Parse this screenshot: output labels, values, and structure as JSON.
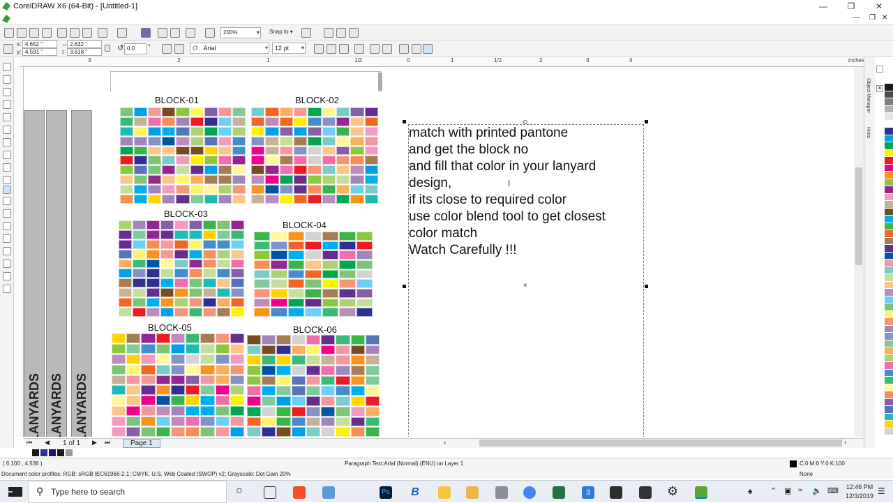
{
  "window": {
    "title": "CorelDRAW X6 (64-Bit) - [Untitled-1]"
  },
  "toolbar": {
    "zoom": "200%",
    "snap_to": "Snap to"
  },
  "property_bar": {
    "x": "4.652 \"",
    "y": "4.591 \"",
    "width": "2.632 \"",
    "height": "3.618 \"",
    "rotation": "0.0",
    "rotation_unit": "°",
    "font": "Arial",
    "font_size": "12 pt"
  },
  "ruler": {
    "units": "inches",
    "top_numbers": [
      "3",
      "2",
      "1",
      "1/2",
      "0",
      "1",
      "1/2",
      "2",
      "3",
      "4"
    ]
  },
  "artwork": {
    "lanyard_text": "LANYARDS",
    "blocks": [
      "BLOCK-01",
      "BLOCK-02",
      "BLOCK-03",
      "BLOCK-04",
      "BLOCK-05",
      "BLOCK-06"
    ]
  },
  "text_object": {
    "lines": [
      "match with printed pantone",
      "and get the block no",
      "and fill that color in your lanyard",
      "design,",
      "if its close to required color",
      "use color blend tool to get closest",
      "color match",
      "Watch Carefully !!!"
    ]
  },
  "page_nav": {
    "counter": "1 of 1",
    "page_tab": "Page 1"
  },
  "status": {
    "coords": "( 6.100 , 4.536 )",
    "object_info": "Paragraph Text:Arial (Normal) (ENU) on Layer 1",
    "fill": "C:0 M:0 Y:0 K:100",
    "outline": "None",
    "profiles": "Document color profiles: RGB: sRGB IEC61966-2.1; CMYK: U.S. Web Coated (SWOP) v2; Grayscale: Dot Gain 20%"
  },
  "docker_tabs": [
    "Object Manager",
    "Hints"
  ],
  "palette_colors": [
    "#1a1a1a",
    "#4d4d4d",
    "#808080",
    "#b3b3b3",
    "#e6e6e6",
    "#ffffff",
    "#2e3192",
    "#00a0e9",
    "#00a651",
    "#fff200",
    "#ed1c24",
    "#ec008c",
    "#f7941d",
    "#8dc63f",
    "#92278f",
    "#f49ac1",
    "#c7b299",
    "#754c24",
    "#00aeef",
    "#39b54a",
    "#f26522",
    "#a67c52",
    "#662d91",
    "#0054a6",
    "#f5989d",
    "#7accc8",
    "#c4df9b",
    "#fdc689",
    "#bd8cbf",
    "#6dcff6",
    "#7cc576",
    "#fff568",
    "#f69679",
    "#a186be",
    "#8393ca",
    "#82ca9c",
    "#fbaf5d",
    "#acd373",
    "#f06eaa",
    "#448ccb",
    "#3cb878",
    "#fff799",
    "#f68e56",
    "#855fa8",
    "#5674b9",
    "#1cbbb4",
    "#ffd400",
    "#d3d3d3"
  ],
  "taskbar": {
    "search_placeholder": "Type here to search",
    "time": "12:46 PM",
    "date": "12/3/2019"
  }
}
